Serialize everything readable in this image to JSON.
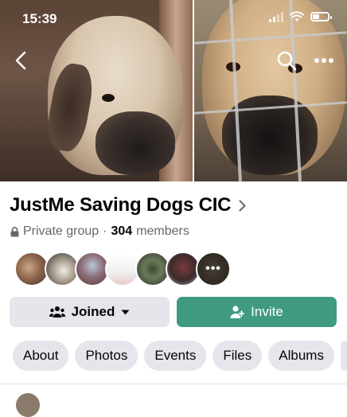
{
  "status_bar": {
    "time": "15:39"
  },
  "group": {
    "name": "JustMe Saving Dogs CIC",
    "privacy": "Private group",
    "separator": "·",
    "member_count": "304",
    "members_label": "members"
  },
  "actions": {
    "joined_label": "Joined",
    "invite_label": "Invite"
  },
  "tabs": [
    {
      "label": "About"
    },
    {
      "label": "Photos"
    },
    {
      "label": "Events"
    },
    {
      "label": "Files"
    },
    {
      "label": "Albums"
    }
  ],
  "avatars": {
    "more_indicator": "•••"
  },
  "colors": {
    "invite_button": "#3f9a80",
    "secondary_button": "#e4e6eb",
    "secondary_text": "#65676b"
  }
}
